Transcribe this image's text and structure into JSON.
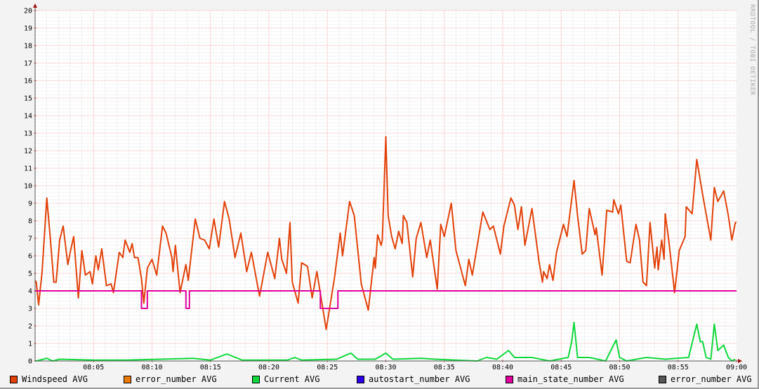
{
  "chart_data": {
    "type": "line",
    "title": "",
    "xlabel": "",
    "ylabel": "",
    "x_unit": "minutes after 08:00",
    "xlim": [
      0,
      60
    ],
    "ylim": [
      0,
      20
    ],
    "grid": true,
    "legend_placement": "bottom",
    "y_ticks": [
      "0",
      "1",
      "2",
      "3",
      "4",
      "5",
      "6",
      "7",
      "8",
      "9",
      "10",
      "11",
      "12",
      "13",
      "14",
      "15",
      "16",
      "17",
      "18",
      "19",
      "20"
    ],
    "x_ticks": [
      {
        "t": 5,
        "label": "08:05"
      },
      {
        "t": 10,
        "label": "08:10"
      },
      {
        "t": 15,
        "label": "08:15"
      },
      {
        "t": 20,
        "label": "08:20"
      },
      {
        "t": 25,
        "label": "08:25"
      },
      {
        "t": 30,
        "label": "08:30"
      },
      {
        "t": 35,
        "label": "08:35"
      },
      {
        "t": 40,
        "label": "08:40"
      },
      {
        "t": 45,
        "label": "08:45"
      },
      {
        "t": 50,
        "label": "08:50"
      },
      {
        "t": 55,
        "label": "08:55"
      },
      {
        "t": 60,
        "label": "09:00"
      }
    ],
    "series": [
      {
        "name": "Windspeed AVG",
        "color": "#e2420a",
        "points": [
          [
            0,
            4.6
          ],
          [
            0.1,
            4.5
          ],
          [
            0.3,
            3.2
          ],
          [
            0.6,
            5.1
          ],
          [
            1.0,
            9.3
          ],
          [
            1.3,
            7.0
          ],
          [
            1.6,
            4.5
          ],
          [
            1.8,
            4.5
          ],
          [
            2.1,
            6.9
          ],
          [
            2.4,
            7.7
          ],
          [
            2.8,
            5.5
          ],
          [
            3.0,
            6.2
          ],
          [
            3.3,
            7.1
          ],
          [
            3.7,
            3.6
          ],
          [
            4.0,
            6.3
          ],
          [
            4.3,
            4.9
          ],
          [
            4.7,
            5.1
          ],
          [
            4.9,
            4.4
          ],
          [
            5.2,
            6.0
          ],
          [
            5.4,
            5.2
          ],
          [
            5.7,
            6.4
          ],
          [
            6.1,
            4.3
          ],
          [
            6.5,
            4.4
          ],
          [
            6.7,
            3.9
          ],
          [
            7.2,
            6.2
          ],
          [
            7.5,
            5.9
          ],
          [
            7.7,
            6.9
          ],
          [
            8.1,
            6.2
          ],
          [
            8.3,
            6.7
          ],
          [
            8.5,
            5.9
          ],
          [
            8.8,
            5.9
          ],
          [
            9.1,
            4.7
          ],
          [
            9.3,
            3.3
          ],
          [
            9.6,
            5.3
          ],
          [
            10.0,
            5.8
          ],
          [
            10.4,
            4.9
          ],
          [
            10.9,
            7.7
          ],
          [
            11.2,
            7.3
          ],
          [
            11.7,
            5.9
          ],
          [
            11.8,
            5.1
          ],
          [
            12.0,
            6.6
          ],
          [
            12.4,
            3.9
          ],
          [
            12.9,
            5.5
          ],
          [
            13.1,
            4.6
          ],
          [
            13.7,
            8.1
          ],
          [
            14.1,
            7.0
          ],
          [
            14.5,
            6.9
          ],
          [
            14.9,
            6.4
          ],
          [
            15.3,
            8.1
          ],
          [
            15.7,
            6.5
          ],
          [
            16.2,
            9.1
          ],
          [
            16.6,
            8.1
          ],
          [
            17.1,
            5.9
          ],
          [
            17.6,
            7.3
          ],
          [
            18.1,
            5.1
          ],
          [
            18.5,
            6.2
          ],
          [
            19.2,
            3.7
          ],
          [
            19.9,
            6.2
          ],
          [
            20.5,
            4.7
          ],
          [
            20.9,
            7.0
          ],
          [
            21.1,
            5.8
          ],
          [
            21.5,
            5.0
          ],
          [
            21.8,
            7.9
          ],
          [
            22.0,
            4.5
          ],
          [
            22.5,
            3.3
          ],
          [
            22.8,
            5.6
          ],
          [
            23.3,
            5.4
          ],
          [
            23.7,
            3.6
          ],
          [
            24.1,
            5.1
          ],
          [
            24.9,
            1.8
          ],
          [
            25.6,
            4.7
          ],
          [
            26.1,
            7.3
          ],
          [
            26.3,
            6.0
          ],
          [
            26.9,
            9.1
          ],
          [
            27.3,
            8.3
          ],
          [
            27.9,
            4.4
          ],
          [
            28.5,
            2.9
          ],
          [
            29.0,
            5.9
          ],
          [
            29.1,
            5.3
          ],
          [
            29.3,
            7.2
          ],
          [
            29.6,
            6.6
          ],
          [
            29.7,
            6.9
          ],
          [
            30.0,
            12.8
          ],
          [
            30.2,
            8.3
          ],
          [
            30.5,
            7.1
          ],
          [
            30.8,
            6.4
          ],
          [
            31.1,
            7.4
          ],
          [
            31.4,
            6.7
          ],
          [
            31.5,
            8.3
          ],
          [
            31.8,
            7.9
          ],
          [
            32.3,
            4.8
          ],
          [
            32.6,
            7.0
          ],
          [
            33.0,
            7.9
          ],
          [
            33.5,
            5.9
          ],
          [
            33.8,
            6.9
          ],
          [
            34.4,
            4.1
          ],
          [
            34.7,
            7.8
          ],
          [
            35.0,
            7.1
          ],
          [
            35.6,
            9.0
          ],
          [
            36.0,
            6.3
          ],
          [
            36.8,
            4.3
          ],
          [
            37.1,
            5.8
          ],
          [
            37.4,
            4.9
          ],
          [
            38.3,
            8.5
          ],
          [
            38.9,
            7.5
          ],
          [
            39.2,
            7.7
          ],
          [
            39.8,
            6.1
          ],
          [
            40.1,
            7.7
          ],
          [
            40.7,
            9.3
          ],
          [
            41.0,
            8.9
          ],
          [
            41.3,
            7.5
          ],
          [
            41.6,
            8.8
          ],
          [
            41.9,
            6.6
          ],
          [
            42.5,
            8.7
          ],
          [
            43.1,
            5.7
          ],
          [
            43.4,
            4.5
          ],
          [
            43.5,
            5.1
          ],
          [
            43.8,
            4.7
          ],
          [
            44.0,
            5.5
          ],
          [
            44.3,
            4.6
          ],
          [
            44.6,
            6.2
          ],
          [
            45.2,
            7.8
          ],
          [
            45.5,
            7.1
          ],
          [
            46.1,
            10.3
          ],
          [
            46.4,
            8.3
          ],
          [
            46.8,
            6.1
          ],
          [
            47.1,
            6.3
          ],
          [
            47.4,
            8.7
          ],
          [
            47.9,
            7.2
          ],
          [
            48.0,
            7.6
          ],
          [
            48.5,
            4.9
          ],
          [
            48.9,
            8.6
          ],
          [
            49.4,
            8.5
          ],
          [
            49.5,
            9.2
          ],
          [
            49.9,
            8.4
          ],
          [
            50.1,
            8.9
          ],
          [
            50.6,
            5.7
          ],
          [
            50.9,
            5.6
          ],
          [
            51.4,
            7.8
          ],
          [
            51.7,
            6.9
          ],
          [
            52.0,
            4.5
          ],
          [
            52.3,
            4.3
          ],
          [
            52.6,
            7.9
          ],
          [
            53.0,
            5.3
          ],
          [
            53.2,
            6.5
          ],
          [
            53.3,
            5.2
          ],
          [
            53.6,
            6.9
          ],
          [
            53.8,
            5.8
          ],
          [
            53.9,
            8.4
          ],
          [
            54.2,
            6.9
          ],
          [
            54.7,
            3.9
          ],
          [
            55.1,
            6.3
          ],
          [
            55.6,
            7.1
          ],
          [
            55.7,
            8.8
          ],
          [
            56.2,
            8.4
          ],
          [
            56.6,
            11.5
          ],
          [
            57.1,
            9.5
          ],
          [
            57.8,
            6.9
          ],
          [
            58.1,
            9.9
          ],
          [
            58.4,
            9.1
          ],
          [
            58.9,
            9.7
          ],
          [
            59.3,
            8.3
          ],
          [
            59.6,
            6.9
          ],
          [
            59.9,
            7.9
          ],
          [
            60,
            7.9
          ]
        ]
      },
      {
        "name": "error_number AVG",
        "color": "#ea7b00",
        "points": []
      },
      {
        "name": "Current AVG",
        "color": "#10d83c",
        "points": [
          [
            0,
            0.0
          ],
          [
            0.1,
            0.0
          ],
          [
            1.0,
            0.15
          ],
          [
            1.5,
            0.0
          ],
          [
            2.1,
            0.1
          ],
          [
            5.1,
            0.05
          ],
          [
            7.8,
            0.05
          ],
          [
            10.8,
            0.1
          ],
          [
            13.5,
            0.15
          ],
          [
            15.0,
            0.05
          ],
          [
            16.4,
            0.4
          ],
          [
            17.7,
            0.05
          ],
          [
            19.2,
            0.05
          ],
          [
            21.6,
            0.05
          ],
          [
            22.2,
            0.2
          ],
          [
            22.8,
            0.05
          ],
          [
            25.8,
            0.1
          ],
          [
            27.0,
            0.45
          ],
          [
            27.6,
            0.1
          ],
          [
            29.1,
            0.1
          ],
          [
            30.0,
            0.45
          ],
          [
            30.6,
            0.1
          ],
          [
            33.0,
            0.15
          ],
          [
            34.2,
            0.1
          ],
          [
            36.0,
            0.05
          ],
          [
            37.8,
            0.0
          ],
          [
            38.6,
            0.2
          ],
          [
            39.5,
            0.1
          ],
          [
            40.5,
            0.6
          ],
          [
            41.0,
            0.2
          ],
          [
            42.5,
            0.2
          ],
          [
            44.0,
            0.0
          ],
          [
            45.6,
            0.2
          ],
          [
            45.9,
            1.1
          ],
          [
            46.1,
            2.2
          ],
          [
            46.4,
            0.2
          ],
          [
            47.4,
            0.2
          ],
          [
            48.8,
            0.0
          ],
          [
            49.7,
            1.2
          ],
          [
            50.0,
            0.2
          ],
          [
            50.6,
            0.0
          ],
          [
            52.3,
            0.2
          ],
          [
            53.9,
            0.1
          ],
          [
            55.9,
            0.2
          ],
          [
            56.6,
            2.1
          ],
          [
            56.9,
            1.1
          ],
          [
            57.1,
            1.1
          ],
          [
            57.4,
            0.2
          ],
          [
            57.8,
            0.1
          ],
          [
            58.1,
            2.1
          ],
          [
            58.4,
            0.6
          ],
          [
            58.9,
            0.9
          ],
          [
            59.3,
            0.2
          ],
          [
            59.6,
            0.0
          ],
          [
            59.9,
            0.1
          ]
        ]
      },
      {
        "name": "autostart_number AVG",
        "color": "#2a00e8",
        "points": []
      },
      {
        "name": "main_state_number AVG",
        "color": "#e0009c",
        "step": true,
        "points": [
          [
            0,
            4
          ],
          [
            9.1,
            3
          ],
          [
            9.6,
            4
          ],
          [
            12.9,
            3
          ],
          [
            13.2,
            4
          ],
          [
            24.4,
            3
          ],
          [
            25.9,
            4
          ],
          [
            60,
            4
          ]
        ]
      },
      {
        "name": "error_number AVG",
        "color": "#555555",
        "points": []
      }
    ]
  },
  "watermark": "RRDTOOL / TOBI OETIKER"
}
